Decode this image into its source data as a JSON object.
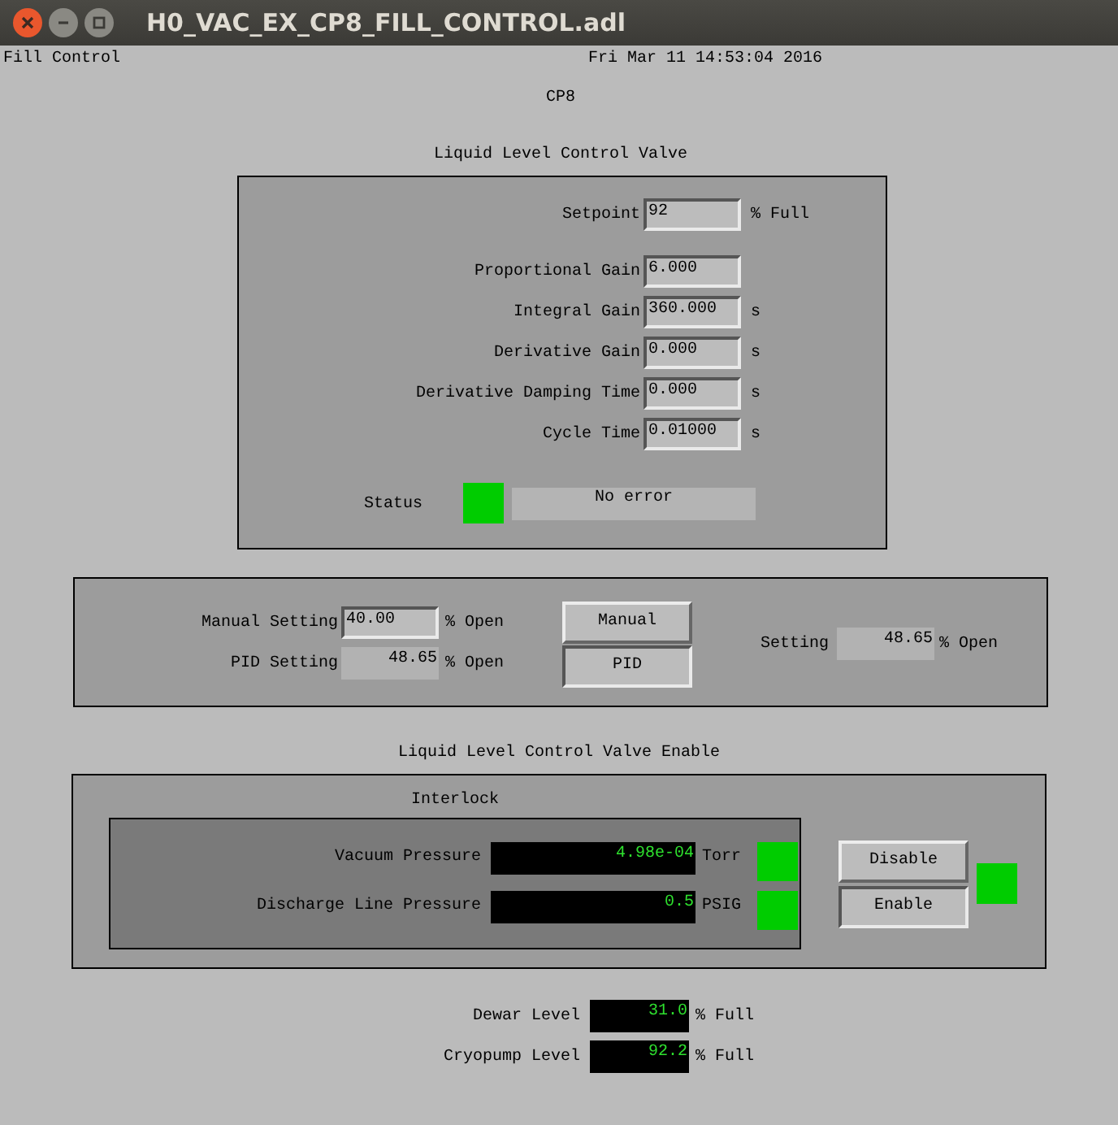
{
  "window": {
    "title": "H0_VAC_EX_CP8_FILL_CONTROL.adl"
  },
  "header": {
    "left": "Fill Control",
    "right": "Fri Mar 11 14:53:04 2016"
  },
  "heading": "CP8",
  "valve": {
    "title": "Liquid Level Control Valve",
    "setpoint": {
      "label": "Setpoint",
      "value": "92",
      "unit": "% Full"
    },
    "params": [
      {
        "label": "Proportional Gain",
        "value": "6.000"
      },
      {
        "label": "Integral Gain",
        "value": "360.000",
        "unit": "s"
      },
      {
        "label": "Derivative Gain",
        "value": "0.000",
        "unit": "s"
      },
      {
        "label": "Derivative Damping Time",
        "value": "0.000",
        "unit": "s"
      },
      {
        "label": "Cycle Time",
        "value": "0.01000",
        "unit": "s"
      }
    ],
    "status": {
      "label": "Status",
      "color": "#00cc00",
      "message": "No error"
    }
  },
  "mode": {
    "rows": [
      {
        "label": "Manual Setting",
        "kind": "entry",
        "value": "40.00",
        "unit": "% Open"
      },
      {
        "label": "PID Setting",
        "kind": "readout",
        "value": "48.65",
        "unit": "% Open"
      }
    ],
    "buttons": [
      {
        "label": "Manual",
        "selected": false
      },
      {
        "label": "PID",
        "selected": true
      }
    ],
    "setting": {
      "label": "Setting",
      "value": "48.65",
      "unit": "% Open"
    }
  },
  "enable": {
    "title": "Liquid Level Control Valve Enable",
    "interlock": {
      "title": "Interlock",
      "rows": [
        {
          "label": "Vacuum Pressure",
          "value": "4.98e-04",
          "unit": "Torr",
          "color": "#00cc00"
        },
        {
          "label": "Discharge Line Pressure",
          "value": "0.5",
          "unit": "PSIG",
          "color": "#00cc00"
        }
      ]
    },
    "buttons": [
      {
        "label": "Disable",
        "selected": false
      },
      {
        "label": "Enable",
        "selected": true
      }
    ],
    "indicator": {
      "color": "#00cc00"
    }
  },
  "levels": [
    {
      "label": "Dewar Level",
      "value": "31.0",
      "unit": "% Full"
    },
    {
      "label": "Cryopump Level",
      "value": "92.2",
      "unit": "% Full"
    }
  ]
}
